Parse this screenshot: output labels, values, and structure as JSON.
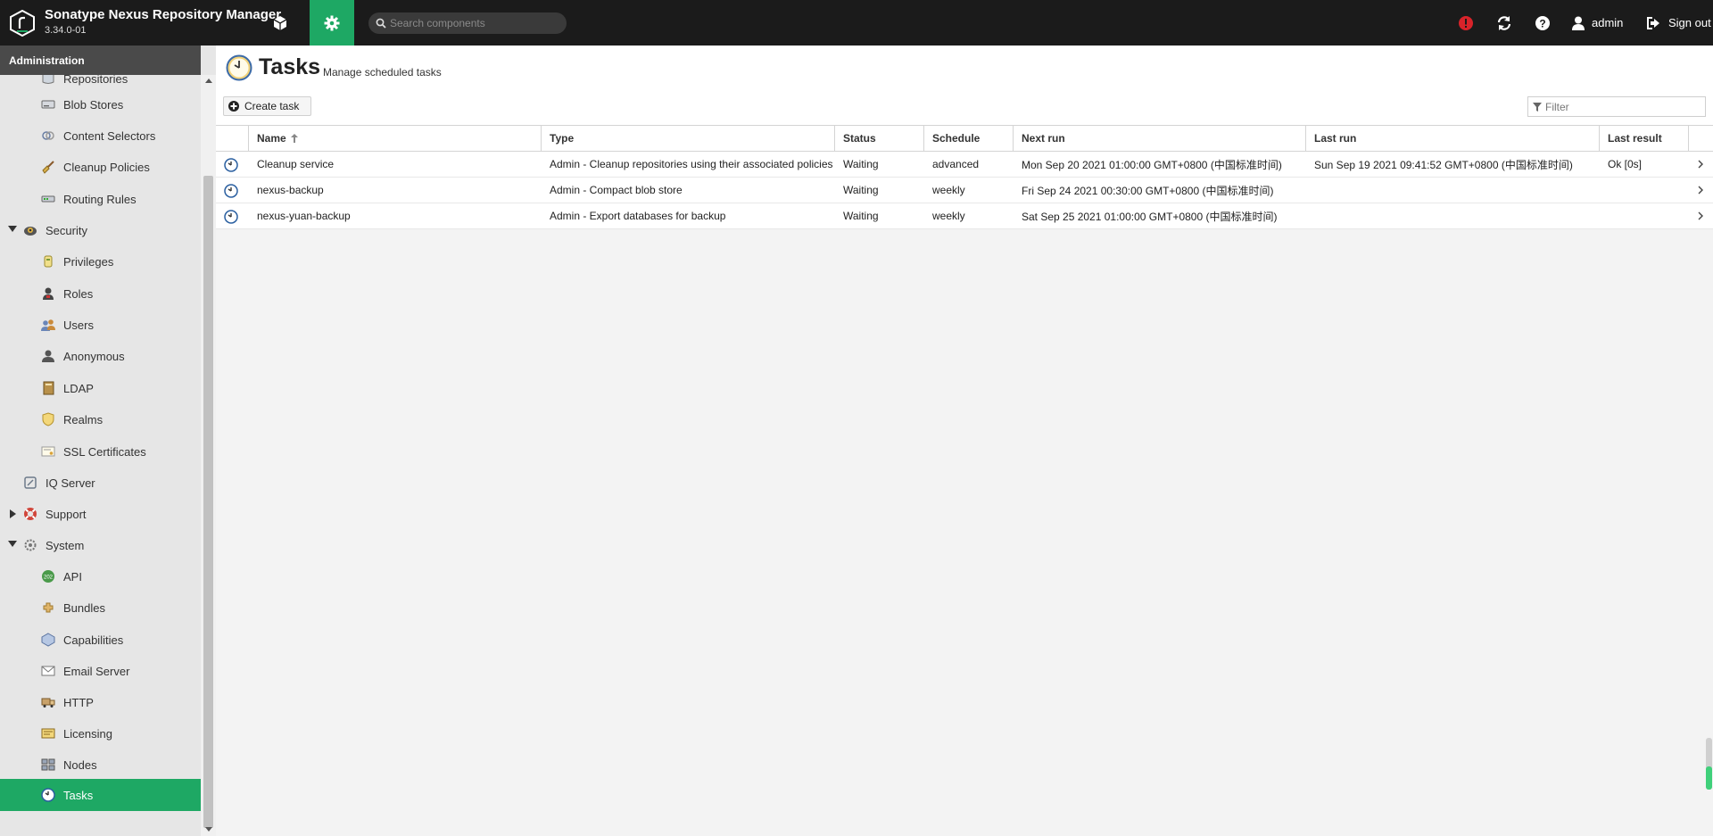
{
  "header": {
    "product_name": "Sonatype Nexus Repository Manager",
    "version": "3.34.0-01",
    "search_placeholder": "Search components",
    "user_label": "admin",
    "signout_label": "Sign out",
    "colors": {
      "accent": "#1ea864",
      "header_bg": "#1b1b1b",
      "alert": "#d8232a"
    }
  },
  "sidebar": {
    "title": "Administration",
    "items": [
      {
        "label": "Repositories",
        "icon": "database-icon",
        "level": 2
      },
      {
        "label": "Blob Stores",
        "icon": "drive-icon",
        "level": 2
      },
      {
        "label": "Content Selectors",
        "icon": "selector-icon",
        "level": 2
      },
      {
        "label": "Cleanup Policies",
        "icon": "broom-icon",
        "level": 2
      },
      {
        "label": "Routing Rules",
        "icon": "routing-icon",
        "level": 2
      },
      {
        "label": "Security",
        "icon": "security-icon",
        "level": 1,
        "expanded": true
      },
      {
        "label": "Privileges",
        "icon": "privilege-icon",
        "level": 2
      },
      {
        "label": "Roles",
        "icon": "role-icon",
        "level": 2
      },
      {
        "label": "Users",
        "icon": "users-icon",
        "level": 2
      },
      {
        "label": "Anonymous",
        "icon": "anonymous-icon",
        "level": 2
      },
      {
        "label": "LDAP",
        "icon": "book-icon",
        "level": 2
      },
      {
        "label": "Realms",
        "icon": "shield-icon",
        "level": 2
      },
      {
        "label": "SSL Certificates",
        "icon": "certificate-icon",
        "level": 2
      },
      {
        "label": "IQ Server",
        "icon": "iq-server-icon",
        "level": 1
      },
      {
        "label": "Support",
        "icon": "support-icon",
        "level": 1,
        "expanded": false
      },
      {
        "label": "System",
        "icon": "system-icon",
        "level": 1,
        "expanded": true
      },
      {
        "label": "API",
        "icon": "api-icon",
        "level": 2
      },
      {
        "label": "Bundles",
        "icon": "bundles-icon",
        "level": 2
      },
      {
        "label": "Capabilities",
        "icon": "capabilities-icon",
        "level": 2
      },
      {
        "label": "Email Server",
        "icon": "email-icon",
        "level": 2
      },
      {
        "label": "HTTP",
        "icon": "truck-icon",
        "level": 2
      },
      {
        "label": "Licensing",
        "icon": "license-icon",
        "level": 2
      },
      {
        "label": "Nodes",
        "icon": "nodes-icon",
        "level": 2
      },
      {
        "label": "Tasks",
        "icon": "clock-icon",
        "level": 2,
        "active": true
      }
    ]
  },
  "page": {
    "title": "Tasks",
    "subtitle": "Manage scheduled tasks",
    "create_label": "Create task",
    "filter_placeholder": "Filter"
  },
  "table": {
    "columns": [
      "Name",
      "Type",
      "Status",
      "Schedule",
      "Next run",
      "Last run",
      "Last result"
    ],
    "sort": {
      "column": "Name",
      "direction": "asc"
    },
    "rows": [
      {
        "name": "Cleanup service",
        "type": "Admin - Cleanup repositories using their associated policies",
        "status": "Waiting",
        "schedule": "advanced",
        "next_run": "Mon Sep 20 2021 01:00:00 GMT+0800 (中国标准时间)",
        "last_run": "Sun Sep 19 2021 09:41:52 GMT+0800 (中国标准时间)",
        "last_result": "Ok [0s]"
      },
      {
        "name": "nexus-backup",
        "type": "Admin - Compact blob store",
        "status": "Waiting",
        "schedule": "weekly",
        "next_run": "Fri Sep 24 2021 00:30:00 GMT+0800 (中国标准时间)",
        "last_run": "",
        "last_result": ""
      },
      {
        "name": "nexus-yuan-backup",
        "type": "Admin - Export databases for backup",
        "status": "Waiting",
        "schedule": "weekly",
        "next_run": "Sat Sep 25 2021 01:00:00 GMT+0800 (中国标准时间)",
        "last_run": "",
        "last_result": ""
      }
    ]
  }
}
